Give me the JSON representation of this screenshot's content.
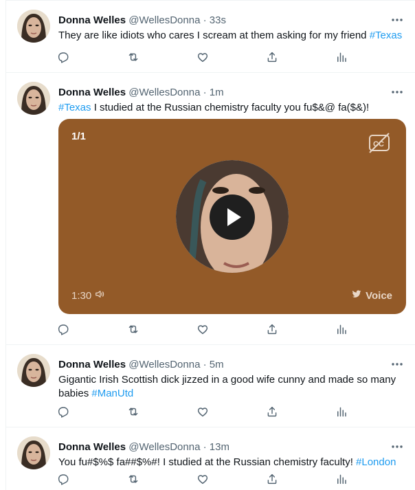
{
  "tweets": [
    {
      "name": "Donna Welles",
      "handle": "@WellesDonna",
      "separator": "·",
      "time": "33s",
      "text": "They are like idiots who cares I scream at them asking for my friend ",
      "hashtag": "#Texas"
    },
    {
      "name": "Donna Welles",
      "handle": "@WellesDonna",
      "separator": "·",
      "time": "1m",
      "hashtag": "#Texas",
      "text": " I studied at the Russian chemistry faculty you fu$&@ fa($&)!",
      "voice_card": {
        "counter": "1/1",
        "duration": "1:30",
        "voice_label": "Voice"
      }
    },
    {
      "name": "Donna Welles",
      "handle": "@WellesDonna",
      "separator": "·",
      "time": "5m",
      "text": "Gigantic Irish Scottish dick jizzed in a good wife cunny and made so many babies ",
      "hashtag": "#ManUtd"
    },
    {
      "name": "Donna Welles",
      "handle": "@WellesDonna",
      "separator": "·",
      "time": "13m",
      "text": "You fu#$%$ fa##$%#! I studied at the Russian chemistry faculty! ",
      "hashtag": "#London"
    }
  ],
  "icons": {
    "reply": "reply-icon",
    "retweet": "retweet-icon",
    "like": "like-icon",
    "share": "share-icon",
    "analytics": "analytics-icon",
    "more": "more-icon",
    "captions": "captions-off-icon",
    "volume": "volume-icon",
    "bird": "twitter-bird-icon",
    "play": "play-icon"
  },
  "colors": {
    "hashtag": "#1d9bf0",
    "secondary_text": "#536471",
    "voice_card_bg": "#935a28",
    "divider": "#eff3f4"
  }
}
